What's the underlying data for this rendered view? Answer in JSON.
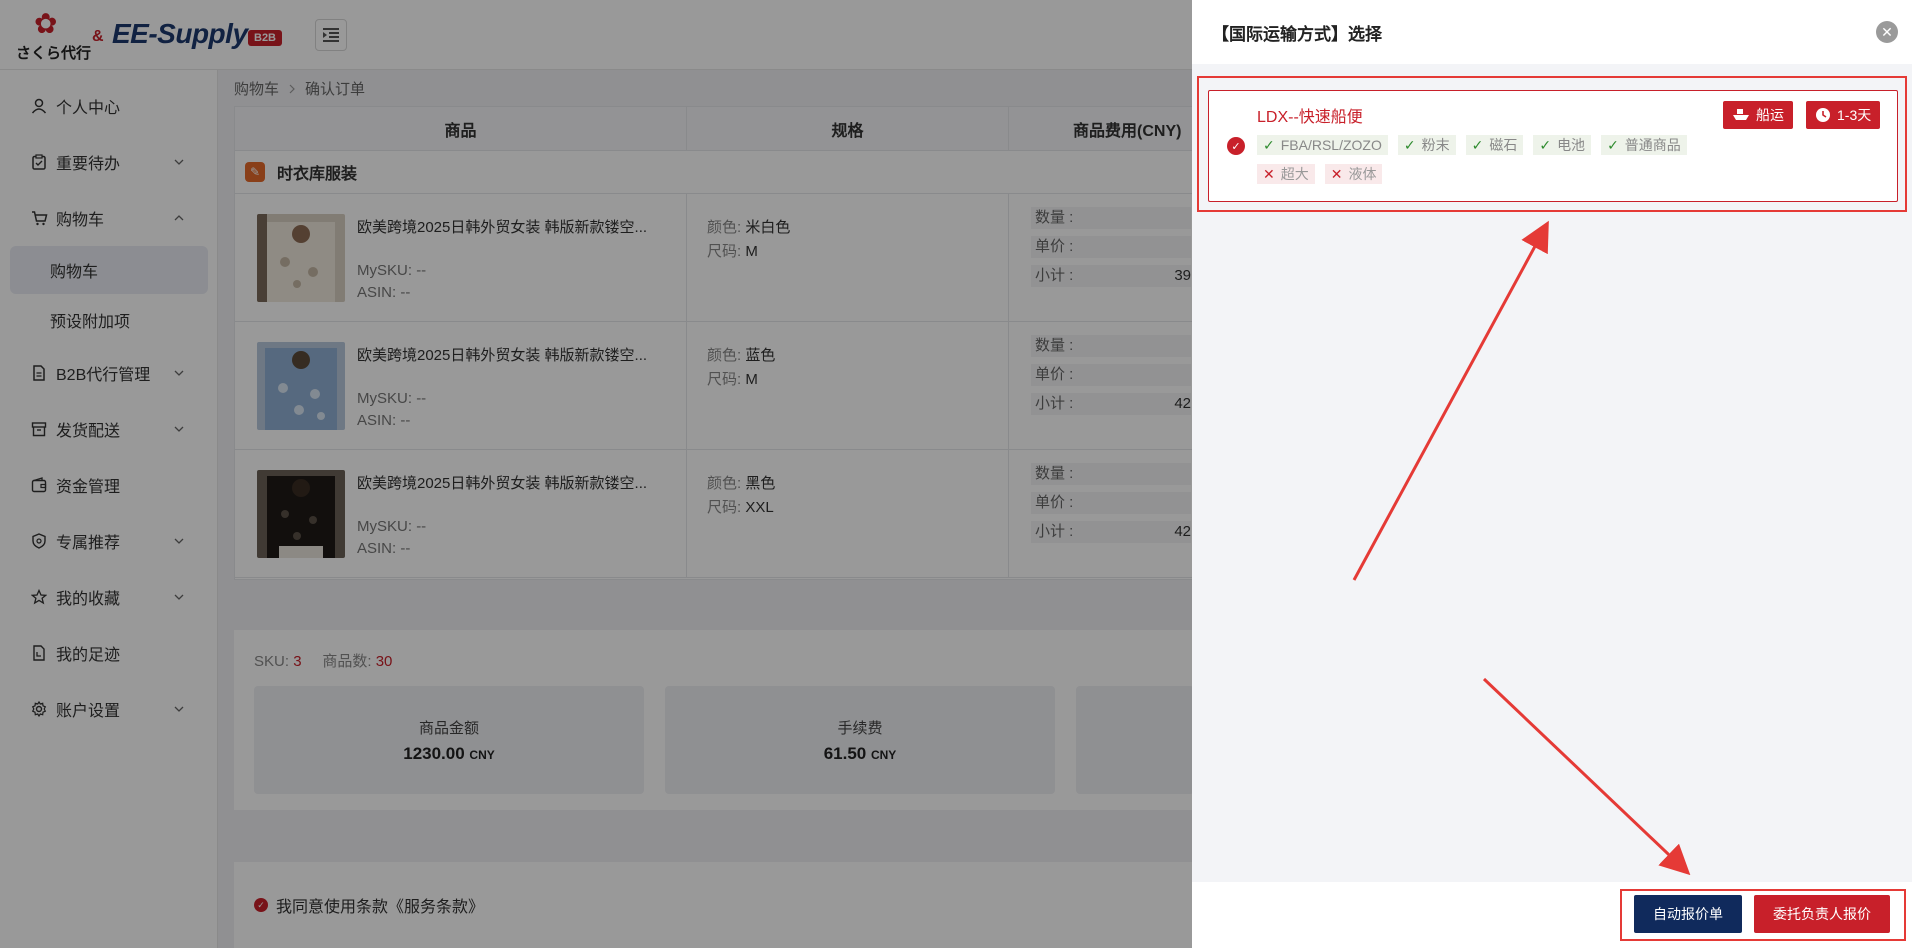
{
  "header": {
    "logo_sakura_text": "さくら代行",
    "logo_amp": "&",
    "logo_ee": "EE-Supply",
    "logo_b2b": "B2B"
  },
  "sidebar": {
    "items": [
      {
        "label": "个人中心",
        "icon": "user-icon"
      },
      {
        "label": "重要待办",
        "icon": "clipboard-icon"
      },
      {
        "label": "购物车",
        "icon": "cart-icon"
      },
      {
        "label": "购物车",
        "icon": ""
      },
      {
        "label": "预设附加项",
        "icon": ""
      },
      {
        "label": "B2B代行管理",
        "icon": "document-icon"
      },
      {
        "label": "发货配送",
        "icon": "box-icon"
      },
      {
        "label": "资金管理",
        "icon": "wallet-icon"
      },
      {
        "label": "专属推荐",
        "icon": "shield-icon"
      },
      {
        "label": "我的收藏",
        "icon": "star-icon"
      },
      {
        "label": "我的足迹",
        "icon": "footprint-icon"
      },
      {
        "label": "账户设置",
        "icon": "gear-icon"
      }
    ]
  },
  "breadcrumb": {
    "root": "购物车",
    "current": "确认订单"
  },
  "table": {
    "headers": [
      "商品",
      "规格",
      "商品费用(CNY)"
    ],
    "shop_name": "时衣库服装",
    "rows": [
      {
        "title": "欧美跨境2025日韩外贸女装 韩版新款镂空...",
        "sku_label": "MySKU:",
        "sku": "--",
        "asin_label": "ASIN:",
        "asin": "--",
        "color_label": "颜色:",
        "color": "米白色",
        "size_label": "尺码:",
        "size": "M",
        "qty_label": "数量 :",
        "price_label": "单价 :",
        "subtotal_label": "小计 :",
        "subtotal_partial": "39"
      },
      {
        "title": "欧美跨境2025日韩外贸女装 韩版新款镂空...",
        "sku_label": "MySKU:",
        "sku": "--",
        "asin_label": "ASIN:",
        "asin": "--",
        "color_label": "颜色:",
        "color": "蓝色",
        "size_label": "尺码:",
        "size": "M",
        "qty_label": "数量 :",
        "price_label": "单价 :",
        "subtotal_label": "小计 :",
        "subtotal_partial": "42"
      },
      {
        "title": "欧美跨境2025日韩外贸女装 韩版新款镂空...",
        "sku_label": "MySKU:",
        "sku": "--",
        "asin_label": "ASIN:",
        "asin": "--",
        "color_label": "颜色:",
        "color": "黑色",
        "size_label": "尺码:",
        "size": "XXL",
        "qty_label": "数量 :",
        "price_label": "单价 :",
        "subtotal_label": "小计 :",
        "subtotal_partial": "42"
      }
    ]
  },
  "summary": {
    "sku_label": "SKU:",
    "sku_count": "3",
    "items_label": "商品数:",
    "items_count": "30",
    "amount_label": "商品金额",
    "amount_value": "1230.00",
    "fee_label": "手续费",
    "fee_value": "61.50",
    "currency": "CNY"
  },
  "agree": {
    "text": "我同意使用条款《服务条款》"
  },
  "drawer": {
    "title": "【国际运输方式】选择",
    "option": {
      "name": "LDX--快速船便",
      "badge_ship": "船运",
      "badge_time": "1-3天",
      "allowed": [
        "FBA/RSL/ZOZO",
        "粉末",
        "磁石",
        "电池",
        "普通商品"
      ],
      "disallowed": [
        "超大",
        "液体"
      ]
    },
    "btn_auto": "自动报价单",
    "btn_agent": "委托负责人报价"
  },
  "colors": {
    "brand_red": "#c8202a",
    "navy": "#102a5c",
    "annotation_red": "#e53a36"
  }
}
